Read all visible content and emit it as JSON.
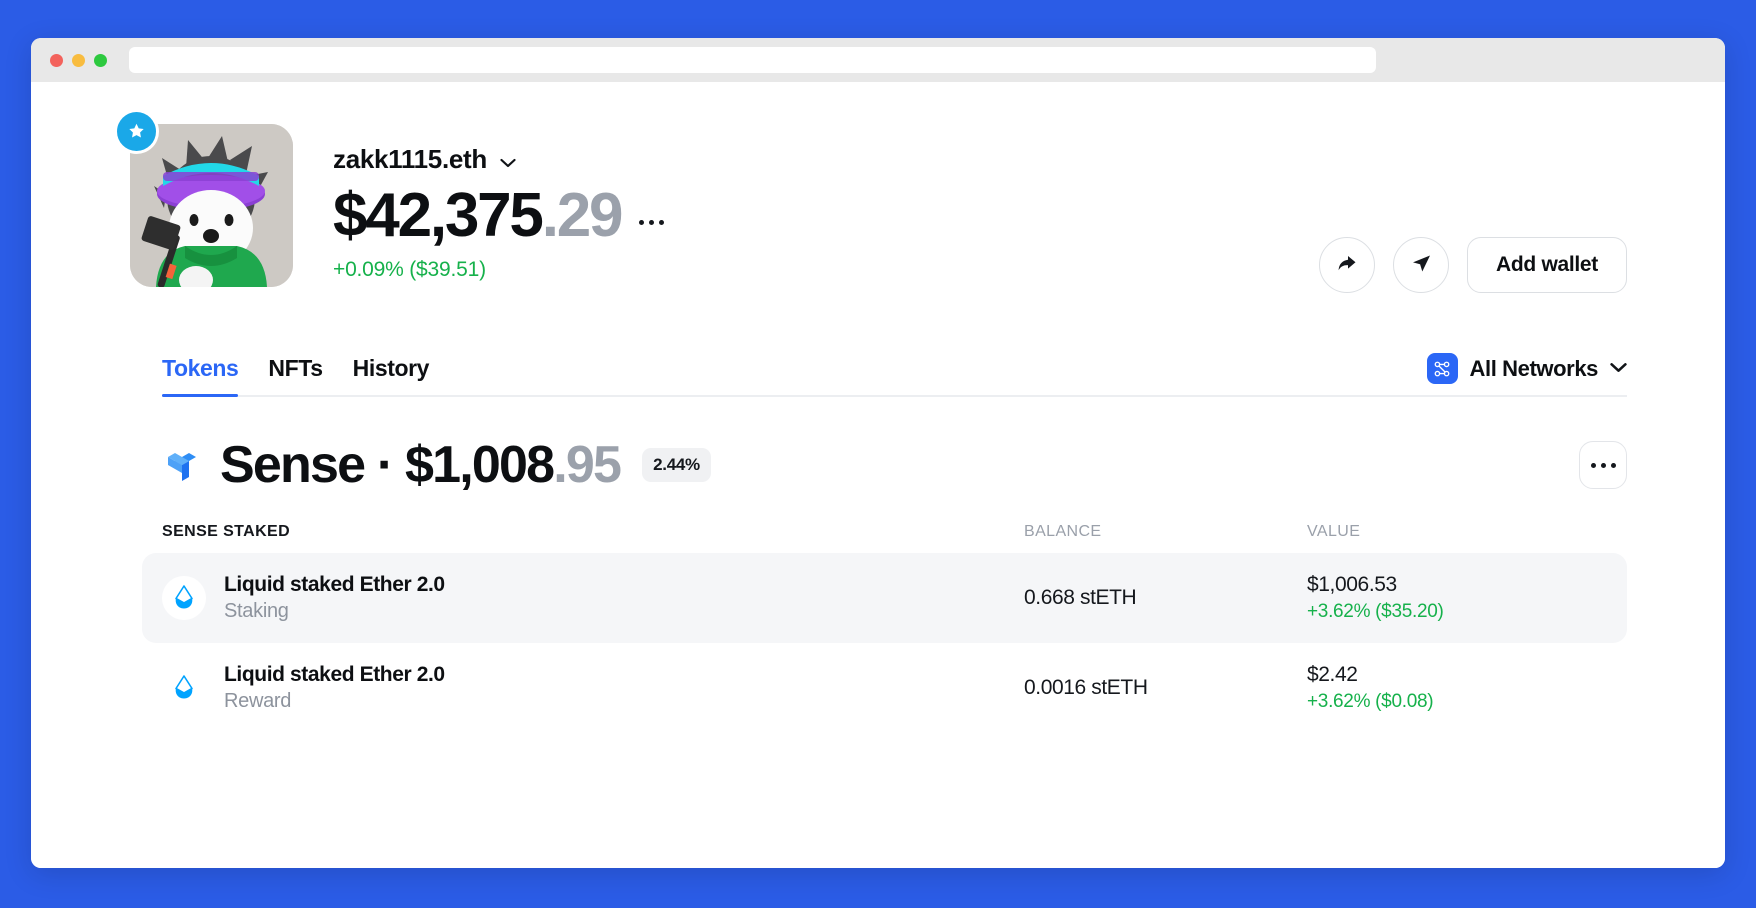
{
  "browser": {
    "traffic_lights": [
      "close",
      "minimize",
      "maximize"
    ],
    "url_value": "",
    "url_placeholder": ""
  },
  "colors": {
    "desktop_bg": "#2b5ce6",
    "accent_blue": "#2b67f6",
    "positive_green": "#16b14b",
    "muted_grey": "#9ba1ab",
    "row_highlight": "#f5f6f8"
  },
  "header": {
    "avatar_alt": "profile-avatar",
    "verified_badge": "star-badge",
    "ens_name": "zakk1115.eth",
    "balance_whole": "$42,375",
    "balance_cents": ".29",
    "change": "+0.09% ($39.51)",
    "more_label": "···",
    "actions": {
      "share_label": "share",
      "send_label": "send",
      "add_wallet_label": "Add wallet"
    }
  },
  "tabs": [
    {
      "label": "Tokens",
      "active": true
    },
    {
      "label": "NFTs",
      "active": false
    },
    {
      "label": "History",
      "active": false
    }
  ],
  "networks": {
    "label": "All Networks",
    "icon": "network-nodes-icon",
    "chevron": "chevron-down-icon"
  },
  "section": {
    "logo": "sense-logo",
    "title_main": "Sense · $1,008",
    "title_cents": ".95",
    "percent_badge": "2.44%",
    "more_label": "more-options"
  },
  "table": {
    "columns": {
      "name": "SENSE STAKED",
      "balance": "BALANCE",
      "value": "VALUE"
    },
    "rows": [
      {
        "icon": "lido-steth-icon",
        "name": "Liquid staked Ether 2.0",
        "subtitle": "Staking",
        "balance": "0.668 stETH",
        "value": "$1,006.53",
        "change": "+3.62% ($35.20)",
        "highlight": true
      },
      {
        "icon": "lido-steth-icon",
        "name": "Liquid staked Ether 2.0",
        "subtitle": "Reward",
        "balance": "0.0016 stETH",
        "value": "$2.42",
        "change": "+3.62% ($0.08)",
        "highlight": false
      }
    ]
  }
}
